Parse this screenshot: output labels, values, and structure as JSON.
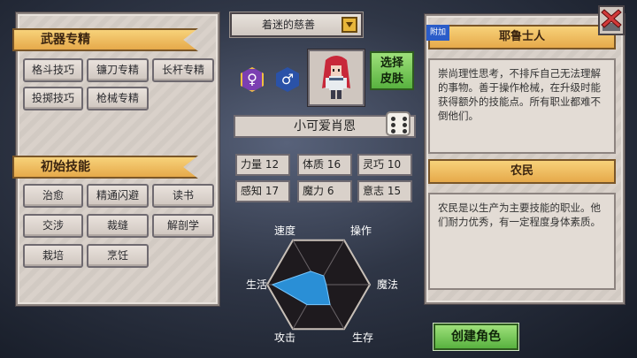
{
  "left_panel": {
    "weapon_section": {
      "title": "武器专精",
      "skills": [
        "格斗技巧",
        "镰刀专精",
        "长杆专精",
        "投掷技巧",
        "枪械专精"
      ]
    },
    "initial_section": {
      "title": "初始技能",
      "skills": [
        "治愈",
        "精通闪避",
        "读书",
        "交涉",
        "裁缝",
        "解剖学",
        "栽培",
        "烹饪"
      ]
    }
  },
  "center": {
    "trait_dropdown": "着迷的慈善",
    "gender_female_icon": "female-symbol",
    "gender_male_icon": "male-symbol",
    "skin_button": [
      "选择",
      "皮肤"
    ],
    "character_name": "小可爱肖恩",
    "stats": [
      {
        "label": "力量",
        "value": "12"
      },
      {
        "label": "体质",
        "value": "16"
      },
      {
        "label": "灵巧",
        "value": "10"
      },
      {
        "label": "感知",
        "value": "17"
      },
      {
        "label": "魔力",
        "value": "6"
      },
      {
        "label": "意志",
        "value": "15"
      }
    ],
    "radar": {
      "axes": [
        "速度",
        "操作",
        "魔法",
        "生存",
        "攻击",
        "生活"
      ],
      "values": [
        0.3,
        0.2,
        0.15,
        0.45,
        0.45,
        0.9
      ]
    }
  },
  "right_panel": {
    "class_1": {
      "badge": "附加",
      "title": "耶鲁士人",
      "description": "崇尚理性思考，不排斥自己无法理解的事物。善于操作枪械，在升级时能获得额外的技能点。所有职业都难不倒他们。"
    },
    "class_2": {
      "title": "农民",
      "description": "农民是以生产为主要技能的职业。他们耐力优秀，有一定程度身体素质。"
    }
  },
  "create_button": "创建角色",
  "colors": {
    "ribbon": "#f0c060",
    "panel": "#d9d1ca",
    "green_button": "#6cc24a",
    "radar_fill": "#2a8fd6",
    "close_red": "#d23a3a"
  }
}
